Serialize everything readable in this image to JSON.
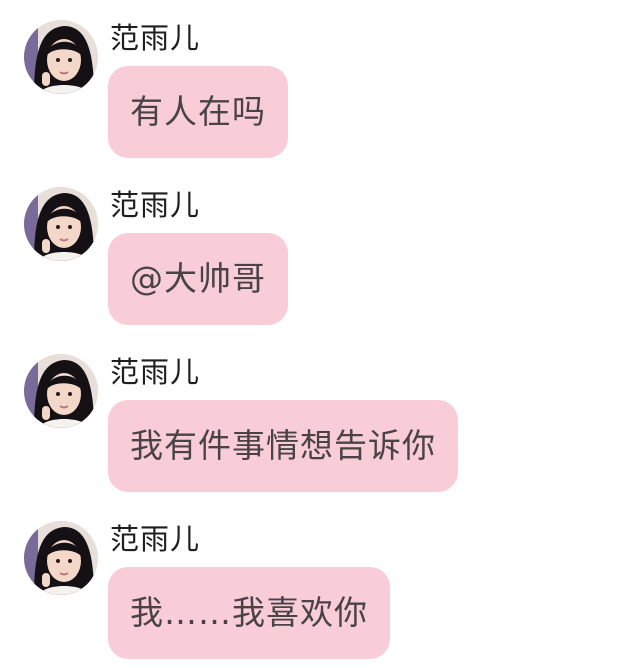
{
  "messages": [
    {
      "sender": "范雨儿",
      "text": "有人在吗"
    },
    {
      "sender": "范雨儿",
      "text": "@大帅哥"
    },
    {
      "sender": "范雨儿",
      "text": "我有件事情想告诉你"
    },
    {
      "sender": "范雨儿",
      "text": "我……我喜欢你"
    }
  ],
  "colors": {
    "bubble": "#f8cdd7",
    "text": "#4a4346",
    "name": "#1f1f1f"
  },
  "icons": {
    "avatar": "user-avatar-photo"
  }
}
